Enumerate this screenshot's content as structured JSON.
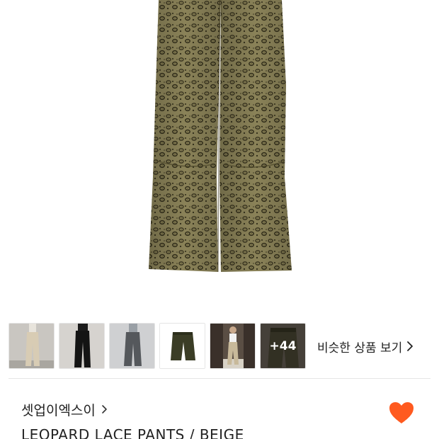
{
  "hero_image": {
    "alt": "leopard print pants"
  },
  "thumbnails": [
    {
      "name": "thumb-beige-pants"
    },
    {
      "name": "thumb-black-pants"
    },
    {
      "name": "thumb-gray-pants"
    },
    {
      "name": "thumb-olive-pants"
    },
    {
      "name": "thumb-model-cargo"
    },
    {
      "name": "thumb-more",
      "more_label": "+44"
    }
  ],
  "similar": {
    "label": "비슷한 상품 보기",
    "icon": "chevron-right-icon"
  },
  "brand": {
    "name": "셋업이엑스이",
    "icon": "chevron-right-icon"
  },
  "wishlist": {
    "icon": "heart-icon",
    "color": "#ff5a1f"
  },
  "product": {
    "title": "LEOPARD LACE PANTS / BEIGE"
  },
  "colors": {
    "accent": "#ff5a1f",
    "divider": "#e6e6e6",
    "text": "#222222"
  }
}
